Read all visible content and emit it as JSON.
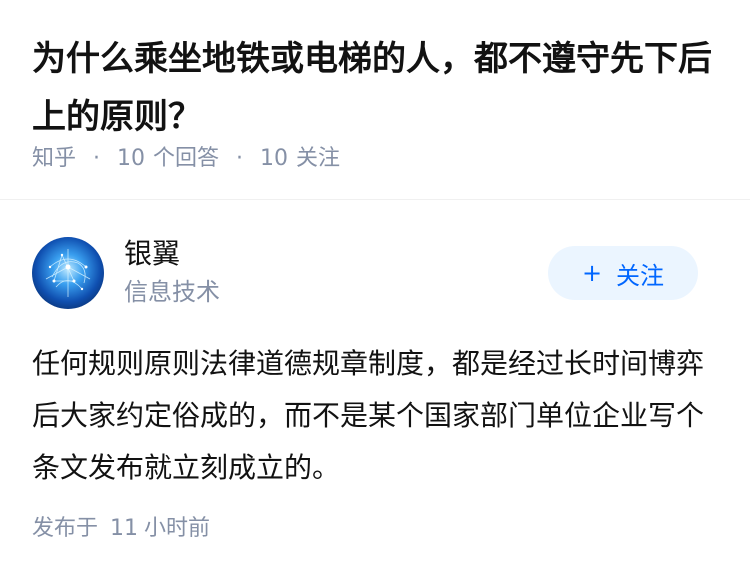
{
  "question": {
    "title": "为什么乘坐地铁或电梯的人，都不遵守先下后上的原则？",
    "source": "知乎",
    "separator": "·",
    "answers_count": "10",
    "answers_label": "个回答",
    "follows_count": "10",
    "follows_label": "关注"
  },
  "answer": {
    "author": {
      "name": "银翼",
      "headline": "信息技术",
      "avatar_icon": "brain-network-avatar"
    },
    "follow_button": {
      "icon": "plus-icon",
      "plus": "+",
      "label": "关注"
    },
    "content": "任何规则原则法律道德规章制度，都是经过长时间博弈后大家约定俗成的，而不是某个国家部门单位企业写个条文发布就立刻成立的。",
    "time": {
      "prefix": "发布于",
      "value": "11",
      "unit": "小时前"
    }
  },
  "colors": {
    "title": "#121212",
    "meta": "#8590a6",
    "accent": "#0066ff",
    "button_bg": "#ebf5ff"
  }
}
